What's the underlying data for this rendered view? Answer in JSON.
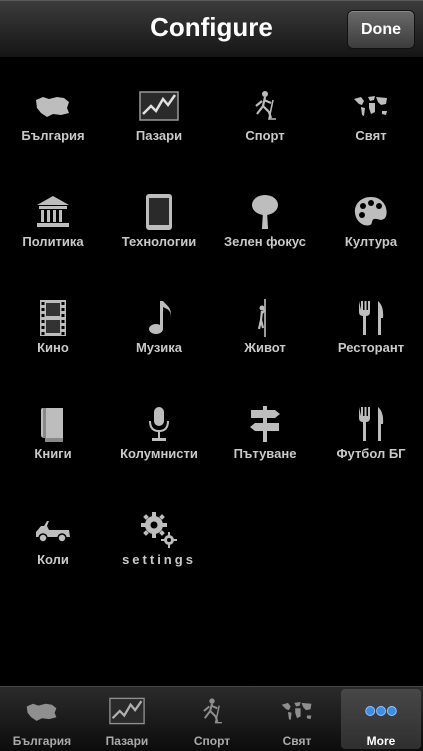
{
  "nav": {
    "title": "Configure",
    "done": "Done"
  },
  "items": [
    {
      "label": "България",
      "icon": "bulgaria-map-icon"
    },
    {
      "label": "Пазари",
      "icon": "market-chart-icon"
    },
    {
      "label": "Спорт",
      "icon": "hockey-player-icon"
    },
    {
      "label": "Свят",
      "icon": "world-map-icon"
    },
    {
      "label": "Политика",
      "icon": "government-building-icon"
    },
    {
      "label": "Технологии",
      "icon": "tablet-icon"
    },
    {
      "label": "Зелен фокус",
      "icon": "tree-icon"
    },
    {
      "label": "Култура",
      "icon": "palette-icon"
    },
    {
      "label": "Кино",
      "icon": "film-strip-icon"
    },
    {
      "label": "Музика",
      "icon": "music-note-icon"
    },
    {
      "label": "Живот",
      "icon": "pole-dancer-icon"
    },
    {
      "label": "Ресторант",
      "icon": "fork-knife-icon"
    },
    {
      "label": "Книги",
      "icon": "book-icon"
    },
    {
      "label": "Колумнисти",
      "icon": "microphone-icon"
    },
    {
      "label": "Пътуване",
      "icon": "signpost-icon"
    },
    {
      "label": "Футбол БГ",
      "icon": "fork-knife-icon"
    },
    {
      "label": "Коли",
      "icon": "jeep-icon"
    },
    {
      "label": "settings",
      "icon": "gears-icon"
    }
  ],
  "tabs": [
    {
      "label": "България",
      "icon": "bulgaria-map-icon"
    },
    {
      "label": "Пазари",
      "icon": "market-chart-icon"
    },
    {
      "label": "Спорт",
      "icon": "hockey-player-icon"
    },
    {
      "label": "Свят",
      "icon": "world-map-icon"
    },
    {
      "label": "More",
      "icon": "more-dots-icon"
    }
  ],
  "colors": {
    "background": "#000000",
    "label": "#c9c9c9",
    "accent_dots": "#3a8ee8"
  }
}
